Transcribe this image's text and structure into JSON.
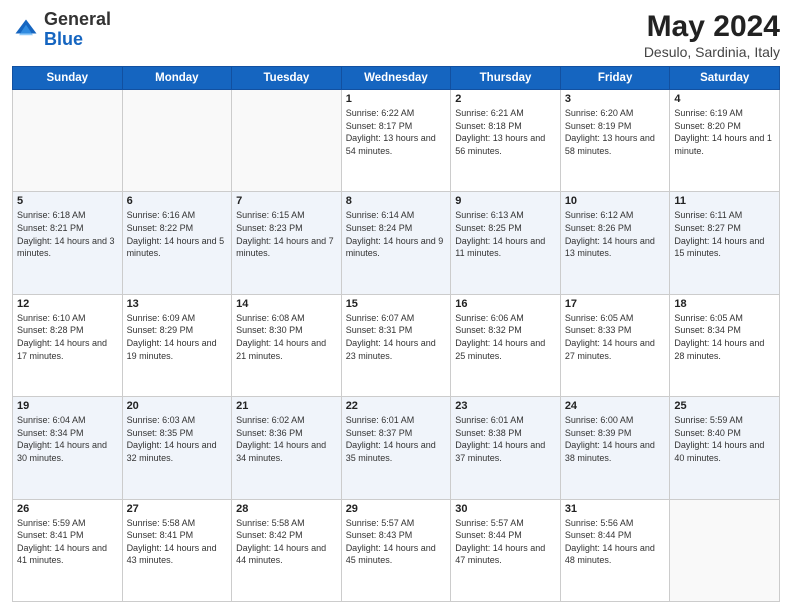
{
  "header": {
    "logo_general": "General",
    "logo_blue": "Blue",
    "title": "May 2024",
    "location": "Desulo, Sardinia, Italy"
  },
  "weekdays": [
    "Sunday",
    "Monday",
    "Tuesday",
    "Wednesday",
    "Thursday",
    "Friday",
    "Saturday"
  ],
  "weeks": [
    [
      {
        "day": "",
        "sunrise": "",
        "sunset": "",
        "daylight": ""
      },
      {
        "day": "",
        "sunrise": "",
        "sunset": "",
        "daylight": ""
      },
      {
        "day": "",
        "sunrise": "",
        "sunset": "",
        "daylight": ""
      },
      {
        "day": "1",
        "sunrise": "Sunrise: 6:22 AM",
        "sunset": "Sunset: 8:17 PM",
        "daylight": "Daylight: 13 hours and 54 minutes."
      },
      {
        "day": "2",
        "sunrise": "Sunrise: 6:21 AM",
        "sunset": "Sunset: 8:18 PM",
        "daylight": "Daylight: 13 hours and 56 minutes."
      },
      {
        "day": "3",
        "sunrise": "Sunrise: 6:20 AM",
        "sunset": "Sunset: 8:19 PM",
        "daylight": "Daylight: 13 hours and 58 minutes."
      },
      {
        "day": "4",
        "sunrise": "Sunrise: 6:19 AM",
        "sunset": "Sunset: 8:20 PM",
        "daylight": "Daylight: 14 hours and 1 minute."
      }
    ],
    [
      {
        "day": "5",
        "sunrise": "Sunrise: 6:18 AM",
        "sunset": "Sunset: 8:21 PM",
        "daylight": "Daylight: 14 hours and 3 minutes."
      },
      {
        "day": "6",
        "sunrise": "Sunrise: 6:16 AM",
        "sunset": "Sunset: 8:22 PM",
        "daylight": "Daylight: 14 hours and 5 minutes."
      },
      {
        "day": "7",
        "sunrise": "Sunrise: 6:15 AM",
        "sunset": "Sunset: 8:23 PM",
        "daylight": "Daylight: 14 hours and 7 minutes."
      },
      {
        "day": "8",
        "sunrise": "Sunrise: 6:14 AM",
        "sunset": "Sunset: 8:24 PM",
        "daylight": "Daylight: 14 hours and 9 minutes."
      },
      {
        "day": "9",
        "sunrise": "Sunrise: 6:13 AM",
        "sunset": "Sunset: 8:25 PM",
        "daylight": "Daylight: 14 hours and 11 minutes."
      },
      {
        "day": "10",
        "sunrise": "Sunrise: 6:12 AM",
        "sunset": "Sunset: 8:26 PM",
        "daylight": "Daylight: 14 hours and 13 minutes."
      },
      {
        "day": "11",
        "sunrise": "Sunrise: 6:11 AM",
        "sunset": "Sunset: 8:27 PM",
        "daylight": "Daylight: 14 hours and 15 minutes."
      }
    ],
    [
      {
        "day": "12",
        "sunrise": "Sunrise: 6:10 AM",
        "sunset": "Sunset: 8:28 PM",
        "daylight": "Daylight: 14 hours and 17 minutes."
      },
      {
        "day": "13",
        "sunrise": "Sunrise: 6:09 AM",
        "sunset": "Sunset: 8:29 PM",
        "daylight": "Daylight: 14 hours and 19 minutes."
      },
      {
        "day": "14",
        "sunrise": "Sunrise: 6:08 AM",
        "sunset": "Sunset: 8:30 PM",
        "daylight": "Daylight: 14 hours and 21 minutes."
      },
      {
        "day": "15",
        "sunrise": "Sunrise: 6:07 AM",
        "sunset": "Sunset: 8:31 PM",
        "daylight": "Daylight: 14 hours and 23 minutes."
      },
      {
        "day": "16",
        "sunrise": "Sunrise: 6:06 AM",
        "sunset": "Sunset: 8:32 PM",
        "daylight": "Daylight: 14 hours and 25 minutes."
      },
      {
        "day": "17",
        "sunrise": "Sunrise: 6:05 AM",
        "sunset": "Sunset: 8:33 PM",
        "daylight": "Daylight: 14 hours and 27 minutes."
      },
      {
        "day": "18",
        "sunrise": "Sunrise: 6:05 AM",
        "sunset": "Sunset: 8:34 PM",
        "daylight": "Daylight: 14 hours and 28 minutes."
      }
    ],
    [
      {
        "day": "19",
        "sunrise": "Sunrise: 6:04 AM",
        "sunset": "Sunset: 8:34 PM",
        "daylight": "Daylight: 14 hours and 30 minutes."
      },
      {
        "day": "20",
        "sunrise": "Sunrise: 6:03 AM",
        "sunset": "Sunset: 8:35 PM",
        "daylight": "Daylight: 14 hours and 32 minutes."
      },
      {
        "day": "21",
        "sunrise": "Sunrise: 6:02 AM",
        "sunset": "Sunset: 8:36 PM",
        "daylight": "Daylight: 14 hours and 34 minutes."
      },
      {
        "day": "22",
        "sunrise": "Sunrise: 6:01 AM",
        "sunset": "Sunset: 8:37 PM",
        "daylight": "Daylight: 14 hours and 35 minutes."
      },
      {
        "day": "23",
        "sunrise": "Sunrise: 6:01 AM",
        "sunset": "Sunset: 8:38 PM",
        "daylight": "Daylight: 14 hours and 37 minutes."
      },
      {
        "day": "24",
        "sunrise": "Sunrise: 6:00 AM",
        "sunset": "Sunset: 8:39 PM",
        "daylight": "Daylight: 14 hours and 38 minutes."
      },
      {
        "day": "25",
        "sunrise": "Sunrise: 5:59 AM",
        "sunset": "Sunset: 8:40 PM",
        "daylight": "Daylight: 14 hours and 40 minutes."
      }
    ],
    [
      {
        "day": "26",
        "sunrise": "Sunrise: 5:59 AM",
        "sunset": "Sunset: 8:41 PM",
        "daylight": "Daylight: 14 hours and 41 minutes."
      },
      {
        "day": "27",
        "sunrise": "Sunrise: 5:58 AM",
        "sunset": "Sunset: 8:41 PM",
        "daylight": "Daylight: 14 hours and 43 minutes."
      },
      {
        "day": "28",
        "sunrise": "Sunrise: 5:58 AM",
        "sunset": "Sunset: 8:42 PM",
        "daylight": "Daylight: 14 hours and 44 minutes."
      },
      {
        "day": "29",
        "sunrise": "Sunrise: 5:57 AM",
        "sunset": "Sunset: 8:43 PM",
        "daylight": "Daylight: 14 hours and 45 minutes."
      },
      {
        "day": "30",
        "sunrise": "Sunrise: 5:57 AM",
        "sunset": "Sunset: 8:44 PM",
        "daylight": "Daylight: 14 hours and 47 minutes."
      },
      {
        "day": "31",
        "sunrise": "Sunrise: 5:56 AM",
        "sunset": "Sunset: 8:44 PM",
        "daylight": "Daylight: 14 hours and 48 minutes."
      },
      {
        "day": "",
        "sunrise": "",
        "sunset": "",
        "daylight": ""
      }
    ]
  ]
}
